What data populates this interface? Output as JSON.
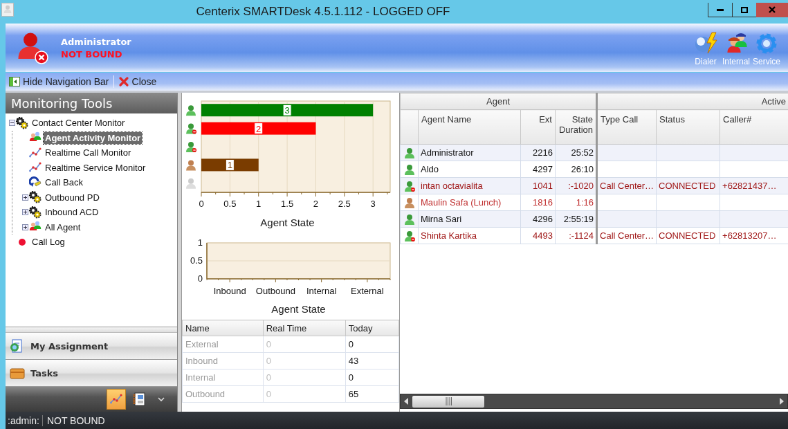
{
  "window": {
    "title": "Centerix SMARTDesk 4.5.1.112 - LOGGED OFF"
  },
  "header": {
    "user": {
      "name": "Administrator",
      "status": "NOT BOUND"
    },
    "actions": [
      {
        "label": "Dialer",
        "kind": "dialer"
      },
      {
        "label": "Internal",
        "kind": "internal"
      },
      {
        "label": "Service",
        "kind": "service"
      }
    ]
  },
  "toolbar": [
    {
      "label": "Hide Navigation Bar",
      "kind": "hide"
    },
    {
      "label": "Close",
      "kind": "close"
    }
  ],
  "nav": {
    "title": "Monitoring Tools",
    "tree": [
      {
        "label": "Contact Center Monitor",
        "kind": "group",
        "expanded": true,
        "selected": false,
        "children": [
          {
            "label": "Agent Activity Monitor",
            "kind": "agents",
            "selected": true
          },
          {
            "label": "Realtime Call Monitor",
            "kind": "monitor",
            "selected": false
          },
          {
            "label": "Realtime Service Monitor",
            "kind": "monitor",
            "selected": false
          },
          {
            "label": "Call Back",
            "kind": "callback",
            "selected": false
          },
          {
            "label": "Outbound PD",
            "kind": "group",
            "expanded": false,
            "selected": false
          },
          {
            "label": "Inbound ACD",
            "kind": "group",
            "expanded": false,
            "selected": false
          },
          {
            "label": "All Agent",
            "kind": "agents",
            "expanded": false,
            "selected": false
          }
        ]
      },
      {
        "label": "Call Log",
        "kind": "log",
        "selected": false
      }
    ],
    "sections": [
      {
        "label": "My Assignment",
        "kind": "assignment"
      },
      {
        "label": "Tasks",
        "kind": "tasks"
      }
    ],
    "switcher": [
      {
        "kind": "monitor",
        "selected": true
      },
      {
        "kind": "notes",
        "selected": false
      }
    ]
  },
  "state_chart": {
    "markers": [
      {
        "kind": "ready"
      },
      {
        "kind": "on_call"
      },
      {
        "kind": "wrap_up"
      },
      {
        "kind": "break"
      },
      {
        "kind": "offline"
      }
    ],
    "chart_data": {
      "type": "bar",
      "orientation": "horizontal",
      "xlabel": "Agent State",
      "xlim": [
        0,
        3.3
      ],
      "xticks": [
        0,
        0.5,
        1,
        1.5,
        2,
        2.5,
        3
      ],
      "grid": true,
      "values": [
        3,
        2,
        0,
        1,
        0
      ],
      "value_labels": [
        "3",
        "2",
        null,
        "1",
        null
      ],
      "colors": [
        "#008000",
        "#ff0000",
        null,
        "#7a3c00",
        null
      ]
    }
  },
  "call_chart": {
    "chart_data": {
      "type": "bar",
      "xlabel": "Agent State",
      "ylim": [
        0,
        1
      ],
      "yticks": [
        0,
        0.5,
        1
      ],
      "grid": true,
      "categories": [
        "Inbound",
        "Outbound",
        "Internal",
        "External"
      ],
      "values": [
        0,
        0,
        0,
        0
      ]
    }
  },
  "summary": {
    "columns": [
      "Name",
      "Real Time",
      "Today"
    ],
    "rows": [
      [
        "External",
        "0",
        "0"
      ],
      [
        "Inbound",
        "0",
        "43"
      ],
      [
        "Internal",
        "0",
        "0"
      ],
      [
        "Outbound",
        "0",
        "65"
      ]
    ]
  },
  "agents": {
    "groups": [
      "Agent",
      "Active"
    ],
    "columns": [
      "Agent Name",
      "Ext",
      "State Duration",
      "Type Call",
      "Status",
      "Caller#"
    ],
    "rows": [
      {
        "kind": "ready",
        "cells": [
          "Administrator",
          "2216",
          "25:52",
          "",
          "",
          ""
        ]
      },
      {
        "kind": "ready",
        "cells": [
          "Aldo",
          "4297",
          "26:10",
          "",
          "",
          ""
        ]
      },
      {
        "kind": "on_call",
        "cells": [
          "intan octavialita",
          "1041",
          ":-1020",
          "Call Center…",
          "CONNECTED",
          "+62821437…"
        ]
      },
      {
        "kind": "break",
        "cells": [
          "Maulin Safa (Lunch)",
          "1816",
          "1:16",
          "",
          "",
          ""
        ]
      },
      {
        "kind": "ready",
        "cells": [
          "Mirna Sari",
          "4296",
          "2:55:19",
          "",
          "",
          ""
        ]
      },
      {
        "kind": "on_call",
        "cells": [
          "Shinta Kartika",
          "4493",
          ":-1124",
          "Call Center…",
          "CONNECTED",
          "+62813207…"
        ]
      }
    ]
  },
  "status_bar": {
    "user": ":admin:",
    "status": "NOT BOUND"
  }
}
